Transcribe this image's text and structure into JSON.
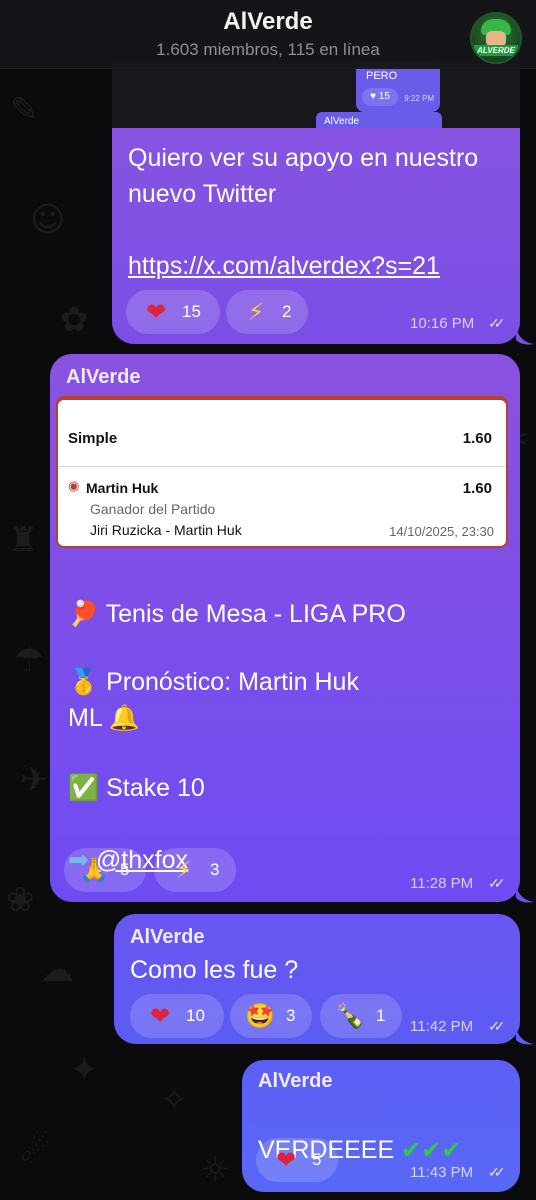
{
  "header": {
    "title": "AlVerde",
    "subtitle": "1.603 miembros, 115 en línea",
    "avatar_text": "ALVERDE"
  },
  "messages": [
    {
      "embedded_preview": {
        "mini_text": "PERO",
        "mini_reaction": "♥ 15",
        "mini_time": "9:22 PM",
        "mini_sender": "AlVerde"
      },
      "text": "Quiero ver su apoyo en nuestro nuevo Twitter",
      "link": "https://x.com/alverdex?s=21",
      "reactions": [
        {
          "icon": "heart-icon",
          "emoji": "❤",
          "count": "15"
        },
        {
          "icon": "lightning-icon",
          "emoji": "⚡",
          "count": "2"
        }
      ],
      "time": "10:16 PM"
    },
    {
      "sender": "AlVerde",
      "bet_slip": {
        "type": "Simple",
        "total_odds": "1.60",
        "player": "Martin Huk",
        "odds": "1.60",
        "market": "Ganador del Partido",
        "match": "Jiri Ruzicka - Martin Huk",
        "datetime": "14/10/2025, 23:30"
      },
      "line1": "Tenis de Mesa - LIGA PRO",
      "line2": "Pronóstico: Martin Huk",
      "line3": "ML",
      "line4": "Stake 10",
      "line5": "@thxfox",
      "reactions": [
        {
          "icon": "pray-icon",
          "emoji": "🙏",
          "count": "5"
        },
        {
          "icon": "lightning-icon",
          "emoji": "⚡",
          "count": "3"
        }
      ],
      "time": "11:28 PM"
    },
    {
      "sender": "AlVerde",
      "text": "Como les fue ?",
      "reactions": [
        {
          "icon": "heart-icon",
          "emoji": "❤",
          "count": "10"
        },
        {
          "icon": "star-struck-icon",
          "emoji": "🤩",
          "count": "3"
        },
        {
          "icon": "champagne-icon",
          "emoji": "🍾",
          "count": "1"
        }
      ],
      "time": "11:42 PM"
    },
    {
      "sender": "AlVerde",
      "text": "VERDEEEE",
      "checks": "✔✔✔",
      "reactions": [
        {
          "icon": "heart-icon",
          "emoji": "❤",
          "count": "5"
        }
      ],
      "time": "11:43 PM"
    }
  ],
  "colors": {
    "bubble_purple": "#8a52e0",
    "bubble_blue": "#5d5ff4",
    "background": "#0b0b0e",
    "heart": "#e0223a"
  }
}
